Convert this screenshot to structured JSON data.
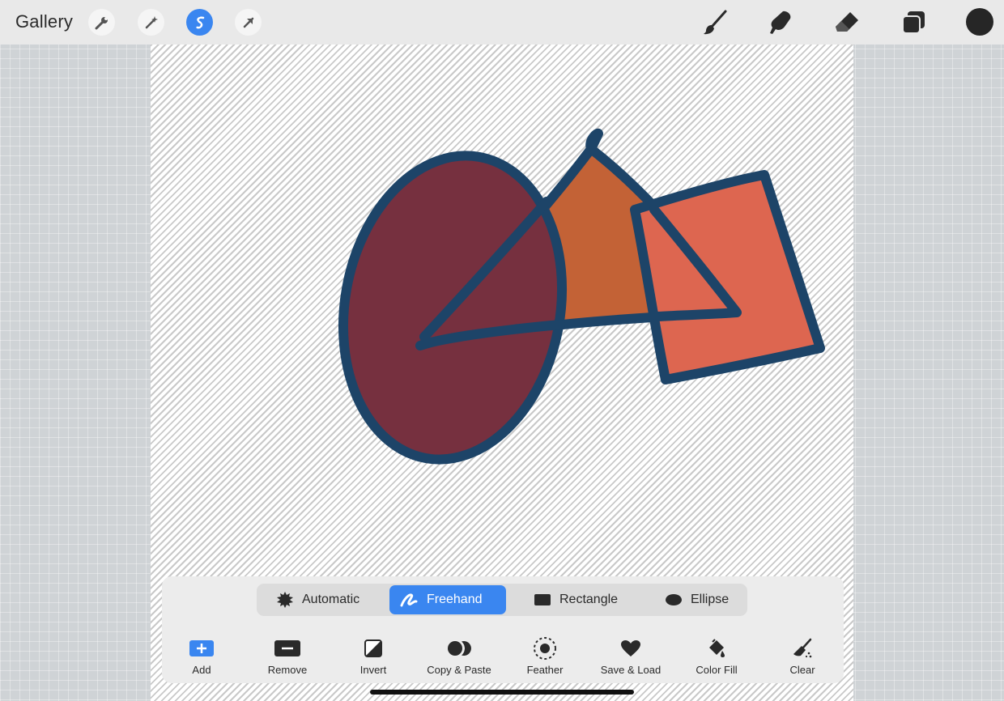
{
  "topbar": {
    "gallery_label": "Gallery",
    "left_tools": [
      "wrench-icon",
      "magic-wand-icon",
      "selection-icon",
      "transform-arrow-icon"
    ],
    "right_tools": [
      "brush-icon",
      "smudge-icon",
      "eraser-icon",
      "layers-icon"
    ],
    "active_color": "#262626",
    "accent": "#3a86f0"
  },
  "selection_modes": [
    {
      "label": "Automatic",
      "icon": "automatic-starburst-icon",
      "active": false
    },
    {
      "label": "Freehand",
      "icon": "freehand-scribble-icon",
      "active": true
    },
    {
      "label": "Rectangle",
      "icon": "rectangle-icon",
      "active": false
    },
    {
      "label": "Ellipse",
      "icon": "ellipse-icon",
      "active": false
    }
  ],
  "actions": [
    {
      "label": "Add",
      "icon": "plus-icon"
    },
    {
      "label": "Remove",
      "icon": "minus-icon"
    },
    {
      "label": "Invert",
      "icon": "invert-icon"
    },
    {
      "label": "Copy & Paste",
      "icon": "copy-paste-icon"
    },
    {
      "label": "Feather",
      "icon": "feather-icon"
    },
    {
      "label": "Save & Load",
      "icon": "heart-icon"
    },
    {
      "label": "Color Fill",
      "icon": "paint-bucket-icon"
    },
    {
      "label": "Clear",
      "icon": "broom-icon"
    }
  ],
  "artwork": {
    "outline_color": "#1d4468",
    "ellipse_fill": "#76303f",
    "triangle_fill": "#c36236",
    "square_fill": "#dd6650"
  }
}
